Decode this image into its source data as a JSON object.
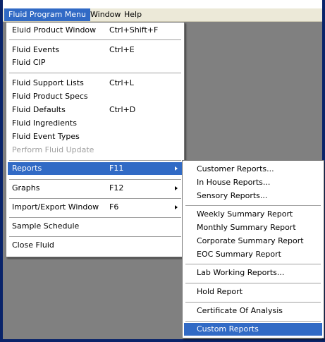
{
  "menubar": {
    "items": [
      {
        "label": "Fluid Program Menu"
      },
      {
        "label": "Window"
      },
      {
        "label": "Help"
      }
    ]
  },
  "main_menu": {
    "items": [
      {
        "label": "Eluid Product Window",
        "shortcut": "Ctrl+Shift+F"
      },
      {
        "label": "Fluid Events",
        "shortcut": "Ctrl+E"
      },
      {
        "label": "Fluid CIP",
        "shortcut": ""
      },
      {
        "label": "Fluid Support Lists",
        "shortcut": "Ctrl+L"
      },
      {
        "label": "Fluid Product Specs",
        "shortcut": ""
      },
      {
        "label": "Fluid Defaults",
        "shortcut": "Ctrl+D"
      },
      {
        "label": "Fluid Ingredients",
        "shortcut": ""
      },
      {
        "label": "Fluid Event Types",
        "shortcut": ""
      },
      {
        "label": "Perform Fluid Update",
        "shortcut": "",
        "disabled": true
      },
      {
        "label": "Reports",
        "shortcut": "F11",
        "submenu": true,
        "highlighted": true
      },
      {
        "label": "Graphs",
        "shortcut": "F12",
        "submenu": true
      },
      {
        "label": "Import/Export Window",
        "shortcut": "F6",
        "submenu": true
      },
      {
        "label": "Sample Schedule",
        "shortcut": ""
      },
      {
        "label": "Close Fluid",
        "shortcut": ""
      }
    ]
  },
  "reports_submenu": {
    "items": [
      {
        "label": "Customer Reports..."
      },
      {
        "label": "In House Reports..."
      },
      {
        "label": "Sensory Reports..."
      },
      {
        "label": "Weekly Summary Report"
      },
      {
        "label": "Monthly Summary Report"
      },
      {
        "label": "Corporate Summary Report"
      },
      {
        "label": "EOC Summary Report"
      },
      {
        "label": "Lab Working Reports..."
      },
      {
        "label": "Hold Report"
      },
      {
        "label": "Certificate Of Analysis"
      },
      {
        "label": "Custom Reports",
        "highlighted": true
      }
    ]
  },
  "colors": {
    "highlight": "#316ac5",
    "menubar_bg": "#ece9d8",
    "workspace_bg": "#808080",
    "frame": "#0a246a"
  }
}
